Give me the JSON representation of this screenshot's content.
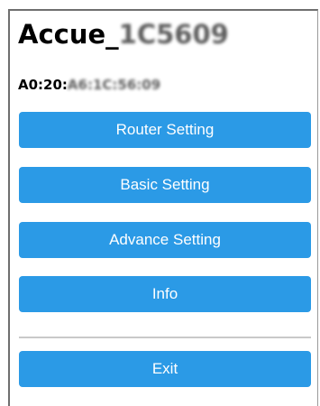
{
  "device": {
    "name_prefix": "Accue_",
    "name_suffix": "1C5609",
    "mac_prefix": "A0:20:",
    "mac_suffix": "A6:1C:56:09"
  },
  "menu": {
    "router_setting_label": "Router Setting",
    "basic_setting_label": "Basic Setting",
    "advance_setting_label": "Advance Setting",
    "info_label": "Info",
    "exit_label": "Exit"
  },
  "colors": {
    "button_background": "#2b9ae6",
    "button_text": "#ffffff",
    "divider": "#c9c9c9"
  }
}
